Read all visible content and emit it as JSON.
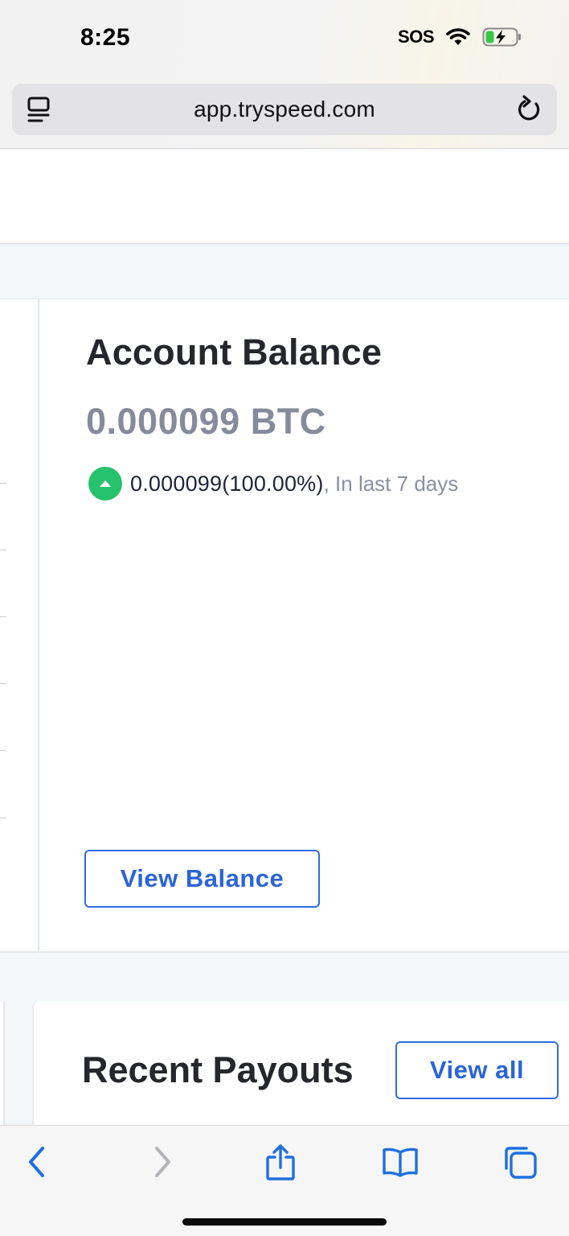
{
  "status_bar": {
    "time": "8:25",
    "carrier": "SOS",
    "icons": [
      "wifi-icon",
      "battery-charging-icon"
    ]
  },
  "browser": {
    "url": "app.tryspeed.com",
    "icons": [
      "reader-icon",
      "reload-icon"
    ]
  },
  "balance_card": {
    "title": "Account Balance",
    "amount": "0.000099 BTC",
    "change_value": "0.000099(100.00%)",
    "change_period": ", In last 7 days",
    "change_direction": "up",
    "button_label": "View Balance"
  },
  "payouts_card": {
    "title": "Recent Payouts",
    "button_label": "View all"
  },
  "toolbar": {
    "items": [
      "back-icon",
      "forward-icon",
      "share-icon",
      "bookmarks-icon",
      "tabs-icon"
    ]
  },
  "colors": {
    "accent": "#2f6de0",
    "positive": "#27c26c",
    "muted_text": "#858b9c",
    "page_background": "#f4f7fa"
  }
}
